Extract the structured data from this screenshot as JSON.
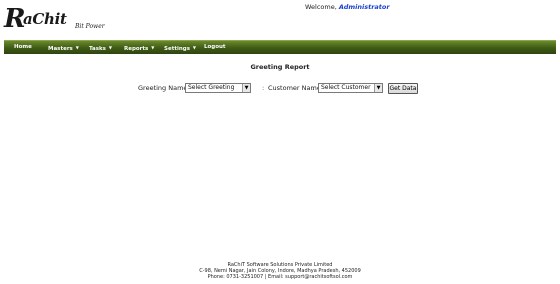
{
  "header": {
    "logo_mark": "R",
    "logo_text": "aChit",
    "logo_tagline": "Bit Power",
    "welcome_prefix": "Welcome,",
    "welcome_user": "Administrator"
  },
  "menu": {
    "home": "Home",
    "masters": "Masters",
    "tasks": "Tasks",
    "reports": "Reports",
    "settings": "Settings",
    "logout": "Logout",
    "caret": "▼"
  },
  "page": {
    "title": "Greeting Report"
  },
  "form": {
    "greeting_label": "Greeting Name",
    "greeting_select": "Select Greeting",
    "customer_label": "Customer Name",
    "customer_select": "Select Customer",
    "colon": ":",
    "get_data": "Get Data"
  },
  "footer": {
    "line1": "RaChiT Software Solutions Private Limited",
    "line2": "C-98, Nemi Nagar, Jain Colony, Indore, Madhya Pradesh, 452009",
    "line3": "Phone: 0731-3251007 | Email: support@rachitsoftsol.com"
  }
}
